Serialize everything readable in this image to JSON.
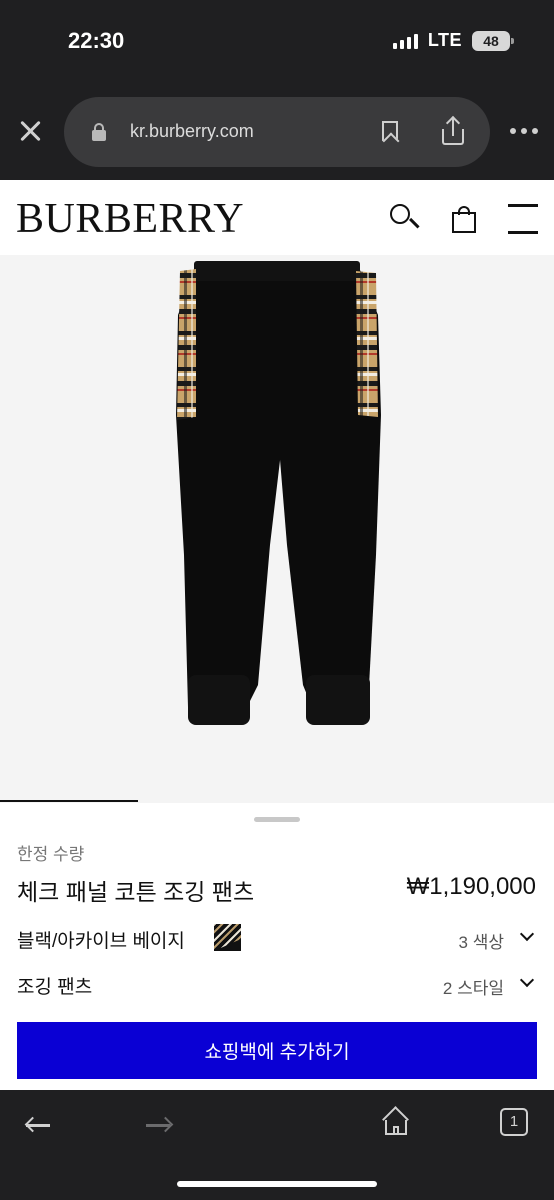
{
  "status_bar": {
    "time": "22:30",
    "network": "LTE",
    "battery": "48"
  },
  "browser": {
    "url": "kr.burberry.com",
    "tab_count": "1"
  },
  "site": {
    "logo": "BURBERRY"
  },
  "product": {
    "limited_label": "한정 수량",
    "title": "체크 패널 코튼 조깅 팬츠",
    "price": "₩1,190,000",
    "color_name": "블랙/아카이브 베이지",
    "color_count": "3 색상",
    "style_name": "조깅 팬츠",
    "style_count": "2 스타일",
    "add_to_bag": "쇼핑백에 추가하기",
    "image_icon": "jogger-pants-image",
    "colors": {
      "pants": "#0c0c0c",
      "check_beige": "#c9a46a",
      "button": "#0a00d4"
    }
  }
}
